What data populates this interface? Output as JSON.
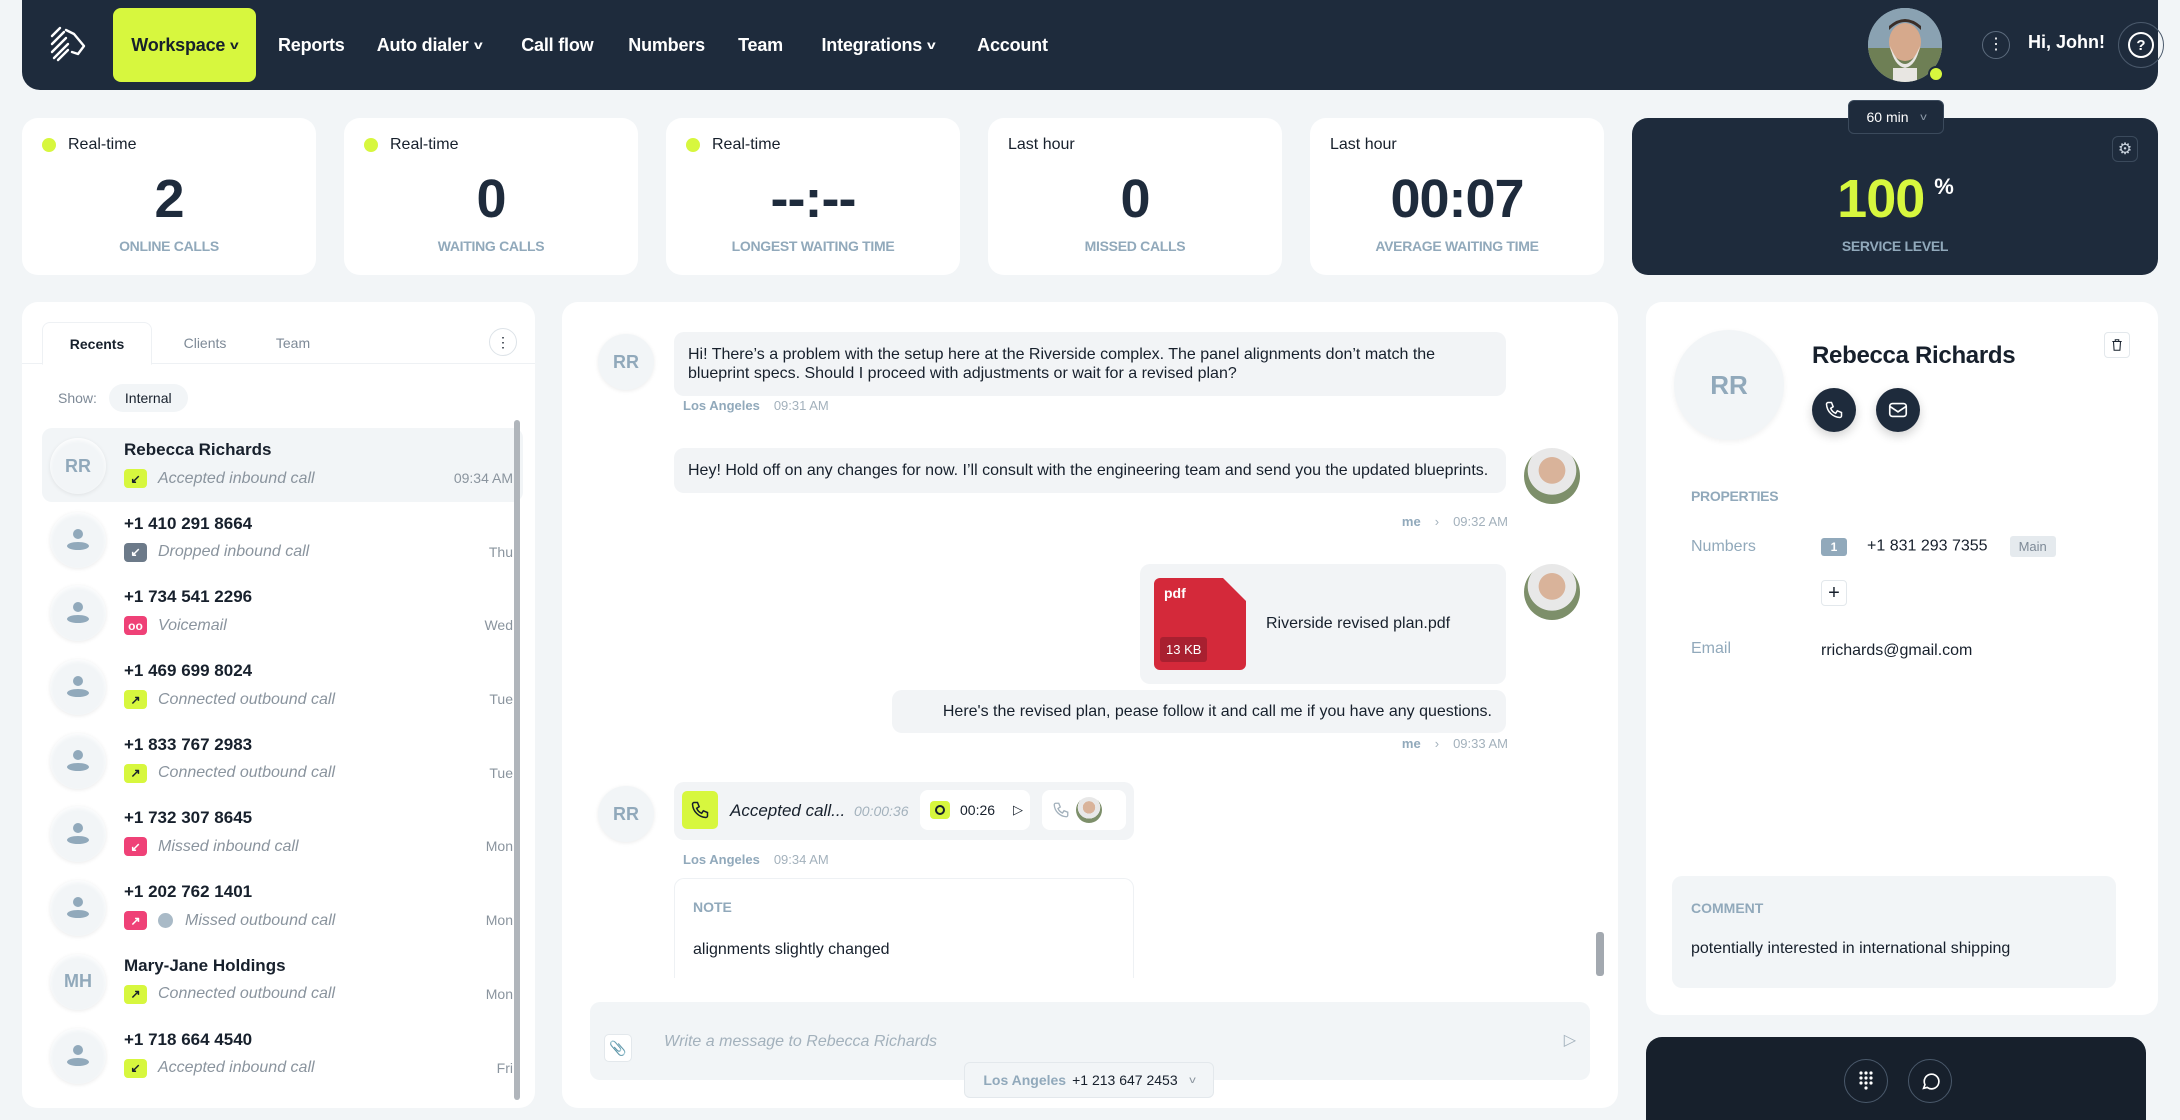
{
  "nav": {
    "items": [
      {
        "label": "Workspace",
        "dropdown": true,
        "active": true
      },
      {
        "label": "Reports",
        "dropdown": false
      },
      {
        "label": "Auto dialer",
        "dropdown": true
      },
      {
        "label": "Call flow",
        "dropdown": false
      },
      {
        "label": "Numbers",
        "dropdown": false
      },
      {
        "label": "Team",
        "dropdown": false
      },
      {
        "label": "Integrations",
        "dropdown": true
      },
      {
        "label": "Account",
        "dropdown": false
      }
    ],
    "greeting": "Hi, John!",
    "help_label": "?",
    "more_label": "⋮",
    "status_color": "#d7f73e",
    "accent": "#d7f73e",
    "navbar_color": "#1e2b3c"
  },
  "stats": [
    {
      "tag": "Real-time",
      "live": true,
      "value": "2",
      "label": "ONLINE CALLS"
    },
    {
      "tag": "Real-time",
      "live": true,
      "value": "0",
      "label": "WAITING CALLS"
    },
    {
      "tag": "Real-time",
      "live": true,
      "value": "--:--",
      "label": "LONGEST WAITING TIME"
    },
    {
      "tag": "Last hour",
      "live": false,
      "value": "0",
      "label": "MISSED CALLS"
    },
    {
      "tag": "Last hour",
      "live": false,
      "value": "00:07",
      "label": "AVERAGE WAITING TIME"
    }
  ],
  "service_level": {
    "value": "100",
    "unit": "%",
    "label": "SERVICE LEVEL",
    "period": "60 min"
  },
  "recents": {
    "tabs": [
      "Recents",
      "Clients",
      "Team"
    ],
    "active_tab": "Recents",
    "show_label": "Show:",
    "filter": "Internal",
    "items": [
      {
        "name": "Rebecca Richards",
        "initials": "RR",
        "status": "Accepted inbound call",
        "type": "inbound",
        "badge": "green",
        "time": "09:34 AM",
        "selected": true
      },
      {
        "name": "+1 410 291 8664",
        "initials": "",
        "status": "Dropped inbound call",
        "type": "inbound",
        "badge": "gray",
        "time": "Thu"
      },
      {
        "name": "+1 734 541 2296",
        "initials": "",
        "status": "Voicemail",
        "type": "voicemail",
        "badge": "pink",
        "time": "Wed"
      },
      {
        "name": "+1 469 699 8024",
        "initials": "",
        "status": "Connected outbound call",
        "type": "outbound",
        "badge": "green",
        "time": "Tue"
      },
      {
        "name": "+1 833 767 2983",
        "initials": "",
        "status": "Connected outbound call",
        "type": "outbound",
        "badge": "green",
        "time": "Tue"
      },
      {
        "name": "+1 732 307 8645",
        "initials": "",
        "status": "Missed inbound call",
        "type": "inbound",
        "badge": "pink",
        "time": "Mon"
      },
      {
        "name": "+1 202 762 1401",
        "initials": "",
        "status": "Missed outbound call",
        "type": "outbound",
        "badge": "pink",
        "globe": true,
        "time": "Mon"
      },
      {
        "name": "Mary-Jane Holdings",
        "initials": "MH",
        "status": "Connected outbound call",
        "type": "outbound",
        "badge": "green",
        "time": "Mon"
      },
      {
        "name": "+1 718 664 4540",
        "initials": "",
        "status": "Accepted inbound call",
        "type": "inbound",
        "badge": "green",
        "time": "Fri"
      }
    ]
  },
  "chat": {
    "contact_initials": "RR",
    "messages": [
      {
        "from": "contact",
        "text": "Hi! There’s a problem with the setup here at the Riverside complex. The panel alignments don’t match the blueprint specs. Should I proceed with adjustments or wait for a revised plan?",
        "location": "Los Angeles",
        "time": "09:31 AM"
      },
      {
        "from": "me",
        "text": "Hey! Hold off on any changes for now. I’ll consult with the engineering team and send you the updated blueprints.",
        "sender": "me",
        "time": "09:32 AM"
      },
      {
        "from": "me",
        "attachment": {
          "ext": "pdf",
          "size": "13 KB",
          "name": "Riverside revised plan.pdf"
        },
        "text": "Here's the revised plan, pease follow it and call me if you have any questions.",
        "sender": "me",
        "time": "09:33 AM"
      }
    ],
    "call": {
      "label": "Accepted call...",
      "duration": "00:00:36",
      "recording": "00:26",
      "location": "Los Angeles",
      "time": "09:34 AM"
    },
    "note": {
      "heading": "NOTE",
      "text": "alignments slightly changed"
    },
    "composer": {
      "placeholder": "Write a message to Rebecca Richards",
      "from_location": "Los Angeles",
      "from_number": "+1 213 647 2453"
    }
  },
  "contact": {
    "initials": "RR",
    "name": "Rebecca Richards",
    "properties_heading": "PROPERTIES",
    "numbers_label": "Numbers",
    "numbers": [
      {
        "index": "1",
        "number": "+1 831 293 7355",
        "tag": "Main"
      }
    ],
    "email_label": "Email",
    "email": "rrichards@gmail.com",
    "comment_heading": "COMMENT",
    "comment": "potentially interested in international shipping"
  }
}
